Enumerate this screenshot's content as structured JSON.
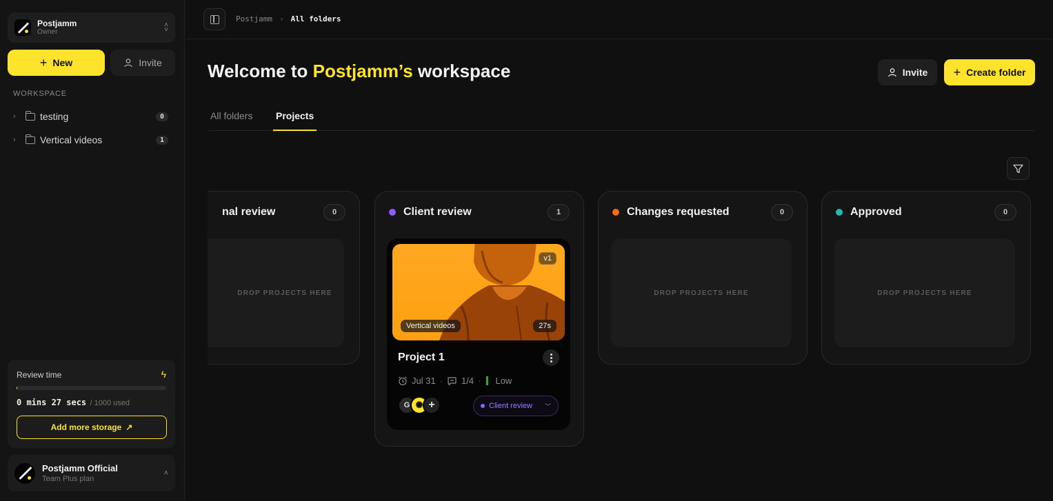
{
  "workspace": {
    "name": "Postjamm",
    "role": "Owner"
  },
  "sidebar": {
    "new_label": "New",
    "invite_label": "Invite",
    "section_label": "WORKSPACE",
    "folders": [
      {
        "label": "testing",
        "count": "0"
      },
      {
        "label": "Vertical videos",
        "count": "1"
      }
    ],
    "review": {
      "title": "Review time",
      "time": "0 mins 27 secs",
      "used": "/ 1000 used",
      "progress_fraction": 0.00045,
      "storage_label": "Add more storage"
    },
    "account": {
      "name": "Postjamm Official",
      "plan": "Team Plus plan"
    }
  },
  "breadcrumb": {
    "root": "Postjamm",
    "current": "All folders"
  },
  "header": {
    "welcome_prefix": "Welcome to ",
    "workspace_name": "Postjamm’s",
    "welcome_suffix": " workspace",
    "invite_label": "Invite",
    "create_label": "Create folder"
  },
  "tabs": [
    {
      "label": "All folders",
      "active": false
    },
    {
      "label": "Projects",
      "active": true
    }
  ],
  "columns": [
    {
      "title": "Internal review",
      "visible_title": "nal review",
      "count": "0",
      "empty_text": "DROP PROJECTS HERE",
      "color": ""
    },
    {
      "title": "Client review",
      "count": "1",
      "color": "#8e5cf7"
    },
    {
      "title": "Changes requested",
      "count": "0",
      "empty_text": "DROP PROJECTS HERE",
      "color": "#f26a1b"
    },
    {
      "title": "Approved",
      "count": "0",
      "empty_text": "DROP PROJECTS HERE",
      "color": "#2ab5b0"
    }
  ],
  "project_card": {
    "version": "v1",
    "folder": "Vertical videos",
    "duration": "27s",
    "title": "Project 1",
    "due": "Jul 31",
    "comments": "1/4",
    "priority": "Low",
    "avatar_initial": "G",
    "status": "Client review"
  },
  "colors": {
    "accent": "#fde32b",
    "background": "#101010"
  }
}
